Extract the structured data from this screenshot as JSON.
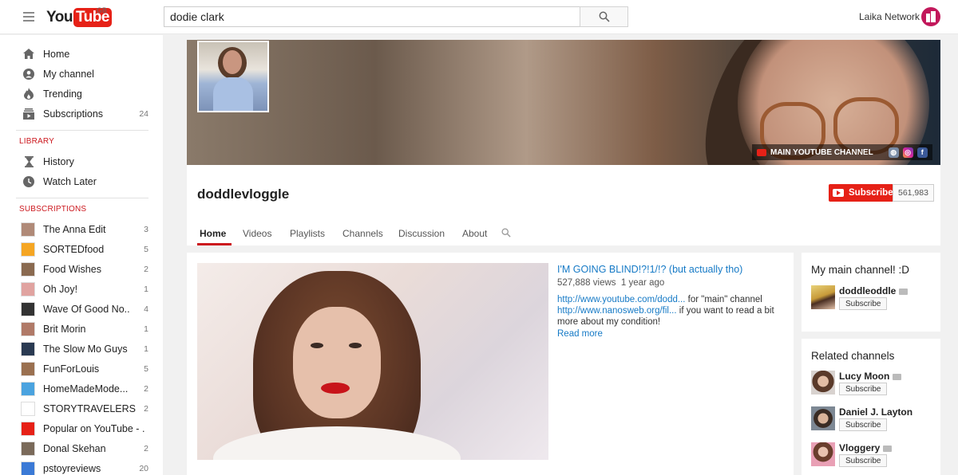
{
  "header": {
    "logo_you": "You",
    "logo_tube": "Tube",
    "region": "GB",
    "search_value": "dodie clark",
    "account_name": "Laika Network"
  },
  "sidebar": {
    "main": [
      {
        "label": "Home",
        "icon": "home-icon"
      },
      {
        "label": "My channel",
        "icon": "person-icon"
      },
      {
        "label": "Trending",
        "icon": "flame-icon"
      },
      {
        "label": "Subscriptions",
        "icon": "subscriptions-icon",
        "count": "24"
      }
    ],
    "library_title": "LIBRARY",
    "library": [
      {
        "label": "History",
        "icon": "hourglass-icon"
      },
      {
        "label": "Watch Later",
        "icon": "clock-icon"
      }
    ],
    "subscriptions_title": "SUBSCRIPTIONS",
    "subscriptions": [
      {
        "label": "The Anna Edit",
        "count": "3",
        "color": "#b08a78"
      },
      {
        "label": "SORTEDfood",
        "count": "5",
        "color": "#f5a623"
      },
      {
        "label": "Food Wishes",
        "count": "2",
        "color": "#8a6a50"
      },
      {
        "label": "Oh Joy!",
        "count": "1",
        "color": "#e0a3a0"
      },
      {
        "label": "Wave Of Good No..",
        "count": "4",
        "color": "#333333"
      },
      {
        "label": "Brit Morin",
        "count": "1",
        "color": "#b07a68"
      },
      {
        "label": "The Slow Mo Guys",
        "count": "1",
        "color": "#2a3a52"
      },
      {
        "label": "FunForLouis",
        "count": "5",
        "color": "#9a7050"
      },
      {
        "label": "HomeMadeMode...",
        "count": "2",
        "color": "#4aa3df"
      },
      {
        "label": "STORYTRAVELERS",
        "count": "2",
        "color": "#ffffff"
      },
      {
        "label": "Popular on YouTube - ...",
        "count": "",
        "color": "#e62117"
      },
      {
        "label": "Donal Skehan",
        "count": "2",
        "color": "#7a6a5a"
      },
      {
        "label": "pstoyreviews",
        "count": "20",
        "color": "#3b7ad6"
      }
    ]
  },
  "channel": {
    "banner_link_text": "MAIN YOUTUBE CHANNEL",
    "name": "doddlevloggle",
    "subscribe_label": "Subscribe",
    "subscriber_count": "561,983",
    "tabs": [
      "Home",
      "Videos",
      "Playlists",
      "Channels",
      "Discussion",
      "About"
    ]
  },
  "featured_video": {
    "title": "I'M GOING BLIND!?!1/!? (but actually tho)",
    "views": "527,888 views",
    "age": "1 year ago",
    "link1": "http://www.youtube.com/dodd...",
    "desc1": " for \"main\" channel",
    "link2": "http://www.nanosweb.org/fil...",
    "desc2": " if you want to read a bit more about my condition!",
    "read_more": "Read more"
  },
  "main_channel_card": {
    "title": "My main channel! :D",
    "channels": [
      {
        "name": "doddleoddle",
        "subscribe": "Subscribe"
      }
    ]
  },
  "related_card": {
    "title": "Related channels",
    "channels": [
      {
        "name": "Lucy Moon",
        "subscribe": "Subscribe"
      },
      {
        "name": "Daniel J. Layton",
        "subscribe": "Subscribe"
      },
      {
        "name": "Vloggery",
        "subscribe": "Subscribe"
      }
    ]
  }
}
